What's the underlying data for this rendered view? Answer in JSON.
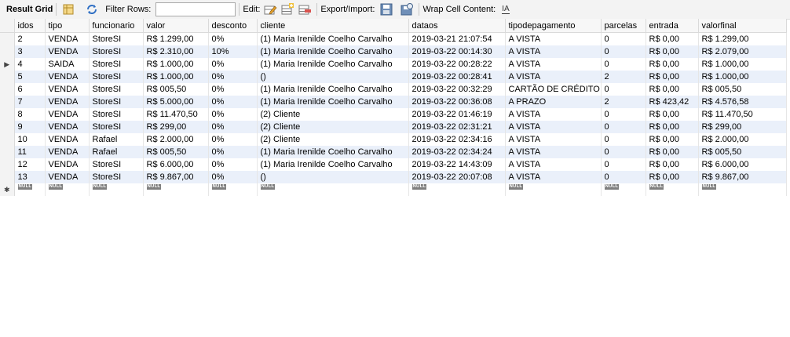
{
  "toolbar": {
    "title": "Result Grid",
    "filter_label": "Filter Rows:",
    "filter_value": "",
    "edit_label": "Edit:",
    "export_label": "Export/Import:",
    "wrap_label": "Wrap Cell Content:",
    "wrap_icon_text": "IA"
  },
  "grid": {
    "columns": [
      "idos",
      "tipo",
      "funcionario",
      "valor",
      "desconto",
      "cliente",
      "dataos",
      "tipodepagamento",
      "parcelas",
      "entrada",
      "valorfinal"
    ],
    "rows": [
      [
        "2",
        "VENDA",
        "StoreSI",
        "R$ 1.299,00",
        "0%",
        "(1) Maria Irenilde Coelho Carvalho",
        "2019-03-21 21:07:54",
        " A VISTA",
        "0",
        "R$ 0,00",
        "R$ 1.299,00"
      ],
      [
        "3",
        "VENDA",
        "StoreSI",
        "R$ 2.310,00",
        "10%",
        "(1) Maria Irenilde Coelho Carvalho",
        "2019-03-22 00:14:30",
        " A VISTA",
        "0",
        "R$ 0,00",
        "R$ 2.079,00"
      ],
      [
        "4",
        "SAIDA",
        "StoreSI",
        "R$ 1.000,00",
        "0%",
        "(1) Maria Irenilde Coelho Carvalho",
        "2019-03-22 00:28:22",
        " A VISTA",
        "0",
        "R$ 0,00",
        "R$ 1.000,00"
      ],
      [
        "5",
        "VENDA",
        "StoreSI",
        "R$ 1.000,00",
        "0%",
        "()",
        "2019-03-22 00:28:41",
        "A VISTA",
        "2",
        "R$ 0,00",
        "R$ 1.000,00"
      ],
      [
        "6",
        "VENDA",
        "StoreSI",
        "R$ 005,50",
        "0%",
        "(1) Maria Irenilde Coelho Carvalho",
        "2019-03-22 00:32:29",
        "CARTÃO DE CRÉDITO",
        "0",
        "R$ 0,00",
        "R$ 005,50"
      ],
      [
        "7",
        "VENDA",
        "StoreSI",
        "R$ 5.000,00",
        "0%",
        "(1) Maria Irenilde Coelho Carvalho",
        "2019-03-22 00:36:08",
        " A PRAZO",
        "2",
        "R$ 423,42",
        "R$ 4.576,58"
      ],
      [
        "8",
        "VENDA",
        "StoreSI",
        "R$ 11.470,50",
        "0%",
        "(2) Cliente",
        "2019-03-22 01:46:19",
        " A VISTA",
        "0",
        "R$ 0,00",
        "R$ 11.470,50"
      ],
      [
        "9",
        "VENDA",
        "StoreSI",
        "R$ 299,00",
        "0%",
        "(2) Cliente",
        "2019-03-22 02:31:21",
        " A VISTA",
        "0",
        "R$ 0,00",
        "R$ 299,00"
      ],
      [
        "10",
        "VENDA",
        "Rafael",
        "R$ 2.000,00",
        "0%",
        "(2) Cliente",
        "2019-03-22 02:34:16",
        " A VISTA",
        "0",
        "R$ 0,00",
        "R$ 2.000,00"
      ],
      [
        "11",
        "VENDA",
        "Rafael",
        "R$ 005,50",
        "0%",
        "(1) Maria Irenilde Coelho Carvalho",
        "2019-03-22 02:34:24",
        " A VISTA",
        "0",
        "R$ 0,00",
        "R$ 005,50"
      ],
      [
        "12",
        "VENDA",
        "StoreSI",
        "R$ 6.000,00",
        "0%",
        "(1) Maria Irenilde Coelho Carvalho",
        "2019-03-22 14:43:09",
        " A VISTA",
        "0",
        "R$ 0,00",
        "R$ 6.000,00"
      ],
      [
        "13",
        "VENDA",
        "StoreSI",
        "R$ 9.867,00",
        "0%",
        "()",
        "2019-03-22 20:07:08",
        " A VISTA",
        "0",
        "R$ 0,00",
        "R$ 9.867,00"
      ]
    ],
    "null_text": "NULL",
    "current_row_index": 2,
    "current_row_marker": "▶",
    "new_row_marker": "✱"
  },
  "icons": [
    "form-view-icon",
    "refresh-icon",
    "edit-row-icon",
    "add-row-icon",
    "delete-row-icon",
    "export-icon",
    "import-icon",
    "wrap-icon"
  ],
  "colors": {
    "alt_row": "#eaf0fa",
    "toolbar_bg": "#f3f3f3",
    "null_badge": "#7f7f7f"
  }
}
